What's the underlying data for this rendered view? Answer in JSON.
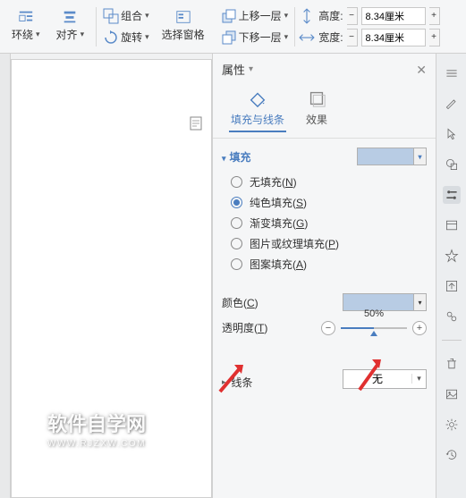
{
  "ribbon": {
    "wrap": "环绕",
    "align": "对齐",
    "group": "组合",
    "rotate": "旋转",
    "select_pane": "选择窗格",
    "forward": "上移一层",
    "backward": "下移一层",
    "height_label": "高度:",
    "width_label": "宽度:",
    "height_value": "8.34厘米",
    "width_value": "8.34厘米"
  },
  "panel": {
    "title": "属性",
    "tabs": {
      "fill": "填充与线条",
      "effect": "效果"
    },
    "fill_section": "填充",
    "radios": {
      "none": "无填充(N)",
      "solid": "纯色填充(S)",
      "gradient": "渐变填充(G)",
      "picture": "图片或纹理填充(P)",
      "pattern": "图案填充(A)"
    },
    "color_label": "颜色(C)",
    "opacity_label": "透明度(T)",
    "opacity_value": "50%",
    "line_section": "线条",
    "line_value": "无",
    "colors": {
      "swatch": "#b8cce4"
    }
  },
  "watermark": {
    "main": "软件自学网",
    "sub": "WWW.RJZXW.COM"
  }
}
